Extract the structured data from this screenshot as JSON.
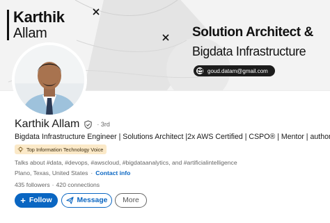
{
  "banner": {
    "first_name": "Karthik",
    "last_name": "Allam",
    "headline_line1": "Solution Architect &",
    "headline_line2": "Bigdata Infrastructure",
    "email": "goud.datam@gmail.com"
  },
  "profile": {
    "name": "Karthik Allam",
    "degree": "· 3rd",
    "headline": "Bigdata Infrastructure Engineer | Solutions Architect |2x AWS Certified | CSPO® | Mentor | author",
    "badge": "Top Information Technology Voice",
    "talks_about": "Talks about #data, #devops, #awscloud, #bigdataanalytics, and #artificialintelligence",
    "location": "Plano, Texas, United States",
    "location_separator": "·",
    "contact_info": "Contact info",
    "followers": "435 followers",
    "stats_separator": "·",
    "connections": "420 connections"
  },
  "actions": {
    "follow": "Follow",
    "follow_icon": "+",
    "message": "Message",
    "more": "More"
  },
  "colors": {
    "accent": "#0a66c2",
    "badge_bg": "#fbe9c8",
    "banner_bg": "#f3f3f3",
    "pill_bg": "#1c1c1c"
  }
}
